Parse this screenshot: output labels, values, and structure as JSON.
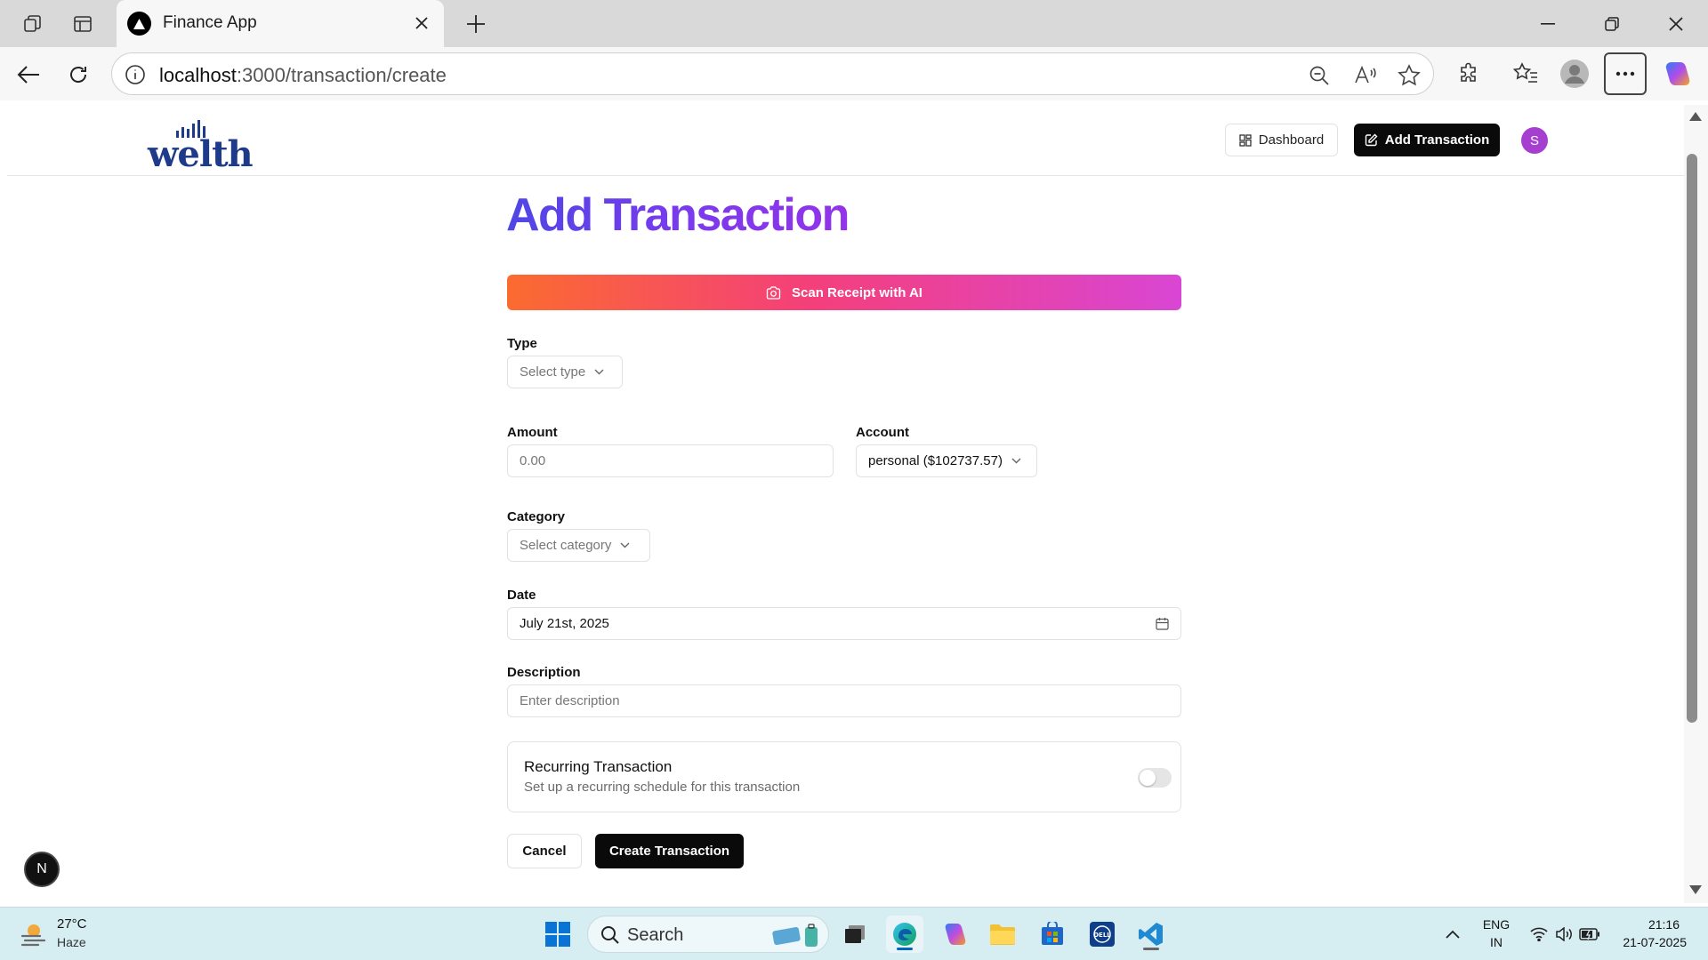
{
  "browser": {
    "tab_title": "Finance App",
    "url_host": "localhost",
    "url_path": ":3000/transaction/create"
  },
  "header": {
    "logo_text": "welth",
    "dashboard_label": "Dashboard",
    "add_transaction_label": "Add Transaction",
    "avatar_initial": "S"
  },
  "form": {
    "title": "Add Transaction",
    "scan_label": "Scan Receipt with AI",
    "type": {
      "label": "Type",
      "placeholder": "Select type"
    },
    "amount": {
      "label": "Amount",
      "placeholder": "0.00"
    },
    "account": {
      "label": "Account",
      "value": "personal ($102737.57)"
    },
    "category": {
      "label": "Category",
      "placeholder": "Select category"
    },
    "date": {
      "label": "Date",
      "value": "July 21st, 2025"
    },
    "description": {
      "label": "Description",
      "placeholder": "Enter description"
    },
    "recurring": {
      "title": "Recurring Transaction",
      "subtitle": "Set up a recurring schedule for this transaction",
      "enabled": false
    },
    "cancel_label": "Cancel",
    "create_label": "Create Transaction"
  },
  "dev_badge": "N",
  "taskbar": {
    "weather_temp": "27°C",
    "weather_desc": "Haze",
    "search_label": "Search",
    "lang_top": "ENG",
    "lang_bottom": "IN",
    "time": "21:16",
    "date": "21-07-2025"
  },
  "colors": {
    "title_gradient": [
      "#4f46e5",
      "#9333ea"
    ],
    "scan_gradient": [
      "#fb6b2f",
      "#d946d4"
    ],
    "primary_button": "#0a0a0a",
    "avatar": "#a63fd0"
  }
}
